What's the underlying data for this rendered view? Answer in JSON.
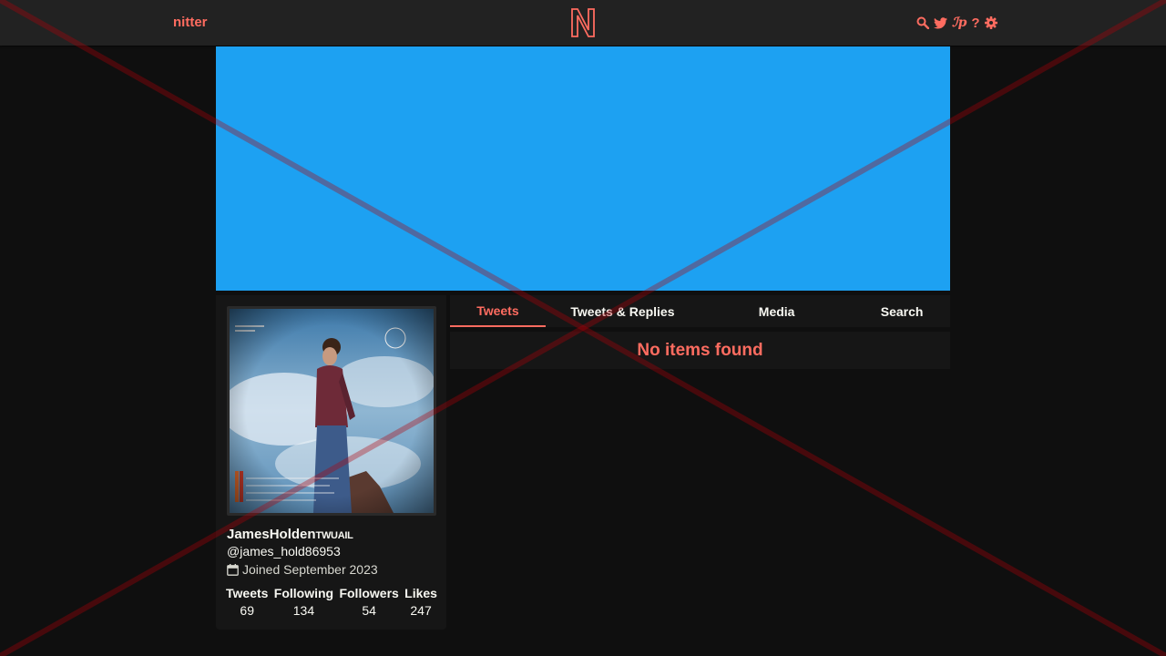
{
  "nav": {
    "brand": "nitter",
    "icons": [
      "search-icon",
      "twitter-bird-icon",
      "rss-icon",
      "help-icon",
      "gear-icon"
    ],
    "rss_glyph": "ℐp",
    "help_glyph": "?"
  },
  "colors": {
    "accent": "#ff6c60",
    "banner": "#1da1f2",
    "background": "#0f0f0f",
    "panel": "#161616",
    "navbar": "#222222"
  },
  "profile": {
    "fullname": "JamesHolden",
    "badge": "TWUAIL",
    "username": "@james_hold86953",
    "joined": "Joined September 2023",
    "stats": [
      {
        "label": "Tweets",
        "value": "69"
      },
      {
        "label": "Following",
        "value": "134"
      },
      {
        "label": "Followers",
        "value": "54"
      },
      {
        "label": "Likes",
        "value": "247"
      }
    ]
  },
  "tabs": [
    {
      "label": "Tweets",
      "active": true
    },
    {
      "label": "Tweets & Replies",
      "active": false
    },
    {
      "label": "Media",
      "active": false
    },
    {
      "label": "Search",
      "active": false
    }
  ],
  "timeline": {
    "empty_message": "No items found"
  }
}
